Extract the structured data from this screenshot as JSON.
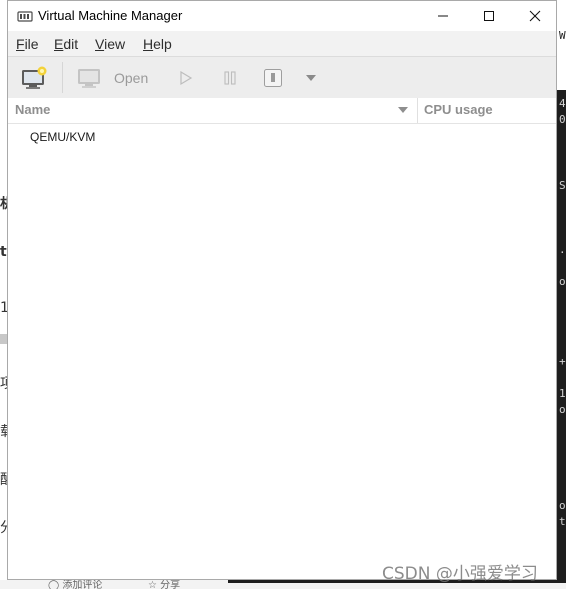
{
  "window": {
    "title": "Virtual Machine Manager"
  },
  "menubar": {
    "items": [
      {
        "label_u": "F",
        "label_rest": "ile"
      },
      {
        "label_u": "E",
        "label_rest": "dit"
      },
      {
        "label_u": "V",
        "label_rest": "iew"
      },
      {
        "label_u": "H",
        "label_rest": "elp"
      }
    ]
  },
  "toolbar": {
    "new_vm_icon": "monitor-new-icon",
    "open_label": "Open",
    "run_icon": "play-icon",
    "pause_icon": "pause-icon",
    "shutdown_icon": "power-icon",
    "menu_icon": "chevron-down-icon"
  },
  "table": {
    "columns": [
      "Name",
      "CPU usage"
    ],
    "rows": [
      {
        "name": "QEMU/KVM"
      }
    ]
  },
  "watermark": "CSDN @小强爱学习",
  "colors": {
    "menubar_bg": "#f2f2f2",
    "toolbar_bg": "#ededed",
    "header_text": "#8e8e8e",
    "disabled_text": "#9a9a9a"
  }
}
